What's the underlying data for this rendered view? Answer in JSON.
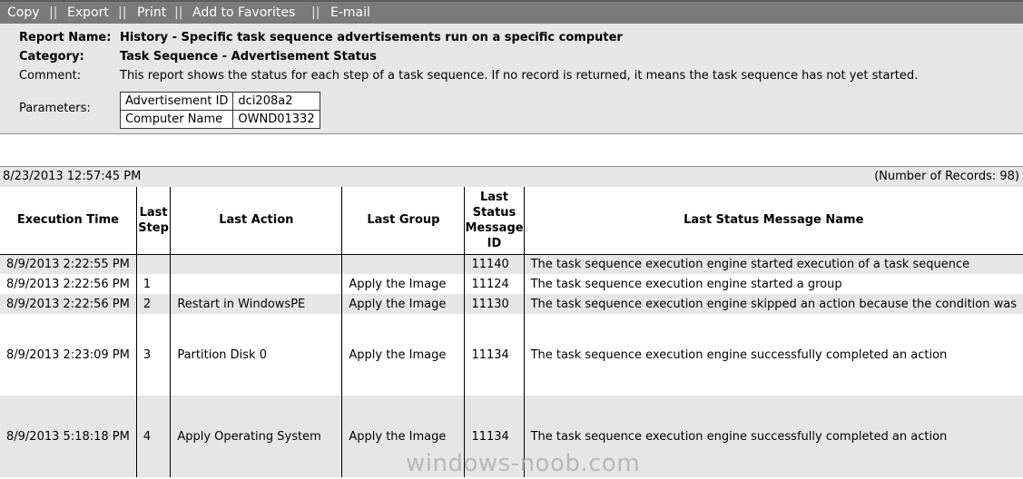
{
  "toolbar": {
    "copy": "Copy",
    "export": "Export",
    "print": "Print",
    "favorites": "Add to Favorites",
    "email": "E-mail",
    "separator": "||"
  },
  "report": {
    "name_label": "Report Name:",
    "name": "History - Specific task sequence advertisements run on a specific computer",
    "category_label": "Category:",
    "category": "Task Sequence - Advertisement Status",
    "comment_label": "Comment:",
    "comment": "This report shows the status for each step of a task sequence. If no record is returned, it means the task sequence has not yet started.",
    "parameters_label": "Parameters:",
    "parameters": [
      {
        "name": "Advertisement ID",
        "value": "dci208a2"
      },
      {
        "name": "Computer Name",
        "value": "OWND01332"
      }
    ]
  },
  "results": {
    "timestamp": "8/23/2013 12:57:45 PM",
    "count": "(Number of Records: 98)"
  },
  "table": {
    "headers": {
      "execution_time": "Execution Time",
      "last_step": "Last Step",
      "last_action": "Last Action",
      "last_group": "Last Group",
      "last_status_id": "Last Status Message ID",
      "last_status_name": "Last Status Message Name"
    },
    "rows": [
      {
        "time": "8/9/2013 2:22:55 PM",
        "step": "",
        "action": "",
        "group": "",
        "id": "11140",
        "msg": "The task sequence execution engine started execution of a task sequence"
      },
      {
        "time": "8/9/2013 2:22:56 PM",
        "step": "1",
        "action": "",
        "group": "Apply the Image",
        "id": "11124",
        "msg": "The task sequence execution engine started a group"
      },
      {
        "time": "8/9/2013 2:22:56 PM",
        "step": "2",
        "action": "Restart in WindowsPE",
        "group": "Apply the Image",
        "id": "11130",
        "msg": "The task sequence execution engine skipped an action because the condition was"
      },
      {
        "time": "8/9/2013 2:23:09 PM",
        "step": "3",
        "action": "Partition Disk 0",
        "group": "Apply the Image",
        "id": "11134",
        "msg": "The task sequence execution engine successfully completed an action"
      },
      {
        "time": "8/9/2013 5:18:18 PM",
        "step": "4",
        "action": "Apply Operating System",
        "group": "Apply the Image",
        "id": "11134",
        "msg": "The task sequence execution engine successfully completed an action"
      }
    ]
  },
  "watermark": "windows-noob.com"
}
